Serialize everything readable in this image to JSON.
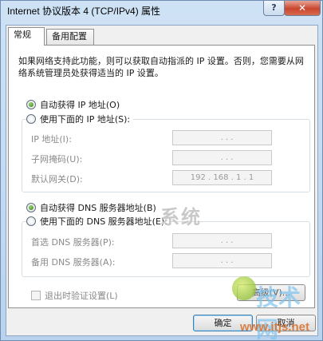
{
  "window": {
    "title": "Internet 协议版本 4 (TCP/IPv4) 属性",
    "help_label": "?",
    "close_label": "✕"
  },
  "tabs": [
    {
      "label": "常规",
      "active": true
    },
    {
      "label": "备用配置",
      "active": false
    }
  ],
  "description": "如果网络支持此功能，则可以获取自动指派的 IP 设置。否则，您需要从网络系统管理员处获得适当的 IP 设置。",
  "ip_section": {
    "auto_label": "自动获得 IP 地址(O)",
    "auto_selected": true,
    "manual_label": "使用下面的 IP 地址(S):",
    "fields": [
      {
        "label": "IP 地址(I):",
        "value": ". . ."
      },
      {
        "label": "子网掩码(U):",
        "value": ". . ."
      },
      {
        "label": "默认网关(D):",
        "value": "192 . 168 . 1 . 1"
      }
    ]
  },
  "dns_section": {
    "auto_label": "自动获得 DNS 服务器地址(B)",
    "auto_selected": true,
    "manual_label": "使用下面的 DNS 服务器地址(E):",
    "fields": [
      {
        "label": "首选 DNS 服务器(P):",
        "value": ". . ."
      },
      {
        "label": "备用 DNS 服务器(A):",
        "value": ". . ."
      }
    ]
  },
  "validate_label": "退出时验证设置(L)",
  "buttons": {
    "advanced": "高级(V)...",
    "ok": "确定",
    "cancel": "取消"
  },
  "watermarks": {
    "system": "系统",
    "site": "技术网",
    "url": "www.itjs.net"
  }
}
